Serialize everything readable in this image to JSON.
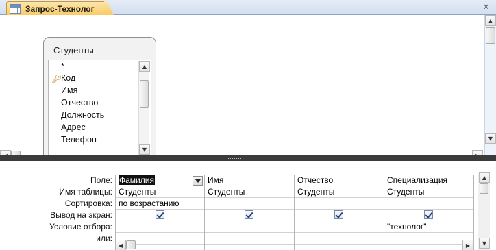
{
  "tab": {
    "title": "Запрос-Технолог",
    "close_glyph": "×"
  },
  "table_card": {
    "title": "Студенты",
    "fields": [
      "*",
      "Код",
      "Имя",
      "Отчество",
      "Должность",
      "Адрес",
      "Телефон"
    ]
  },
  "grid": {
    "row_labels": [
      "Поле:",
      "Имя таблицы:",
      "Сортировка:",
      "Вывод на экран:",
      "Условие отбора:",
      "или:"
    ],
    "columns": [
      {
        "field": "Фамилия",
        "table": "Студенты",
        "sort": "по возрастанию",
        "show": true,
        "criteria": "",
        "or": ""
      },
      {
        "field": "Имя",
        "table": "Студенты",
        "sort": "",
        "show": true,
        "criteria": "",
        "or": ""
      },
      {
        "field": "Отчество",
        "table": "Студенты",
        "sort": "",
        "show": true,
        "criteria": "",
        "or": ""
      },
      {
        "field": "Специализация",
        "table": "Студенты",
        "sort": "",
        "show": true,
        "criteria": "\"технолог\"",
        "or": ""
      }
    ]
  },
  "colors": {
    "tab_gradient_top": "#fde6a9",
    "tab_gradient_bottom": "#f9c963",
    "splitter": "#3b3b3b",
    "checkbox_mark": "#23407a"
  },
  "icons": {
    "tab": "query-icon",
    "key": "primary-key-icon"
  }
}
